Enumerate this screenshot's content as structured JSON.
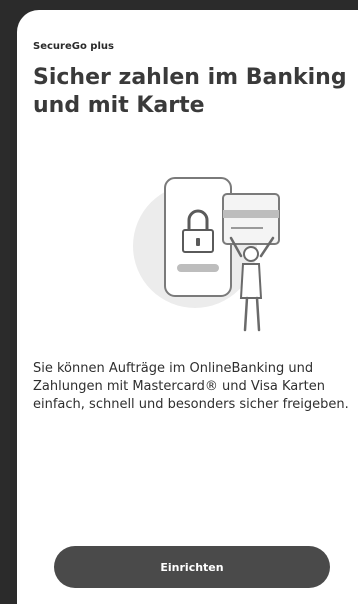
{
  "header": {
    "brand": "SecureGo plus",
    "title": "Sicher zahlen im Banking und mit Karte"
  },
  "illustration": {
    "icon": "phone-lock-card-person-icon"
  },
  "body": {
    "description": "Sie können Aufträge im OnlineBanking und Zahlungen mit Mastercard® und Visa Karten einfach, schnell und besonders sicher freigeben."
  },
  "actions": {
    "setup_label": "Einrichten"
  },
  "colors": {
    "background_frame": "#2b2b2b",
    "screen": "#ffffff",
    "title": "#3a3a3a",
    "button": "#4a4a4a",
    "button_text": "#ffffff"
  }
}
